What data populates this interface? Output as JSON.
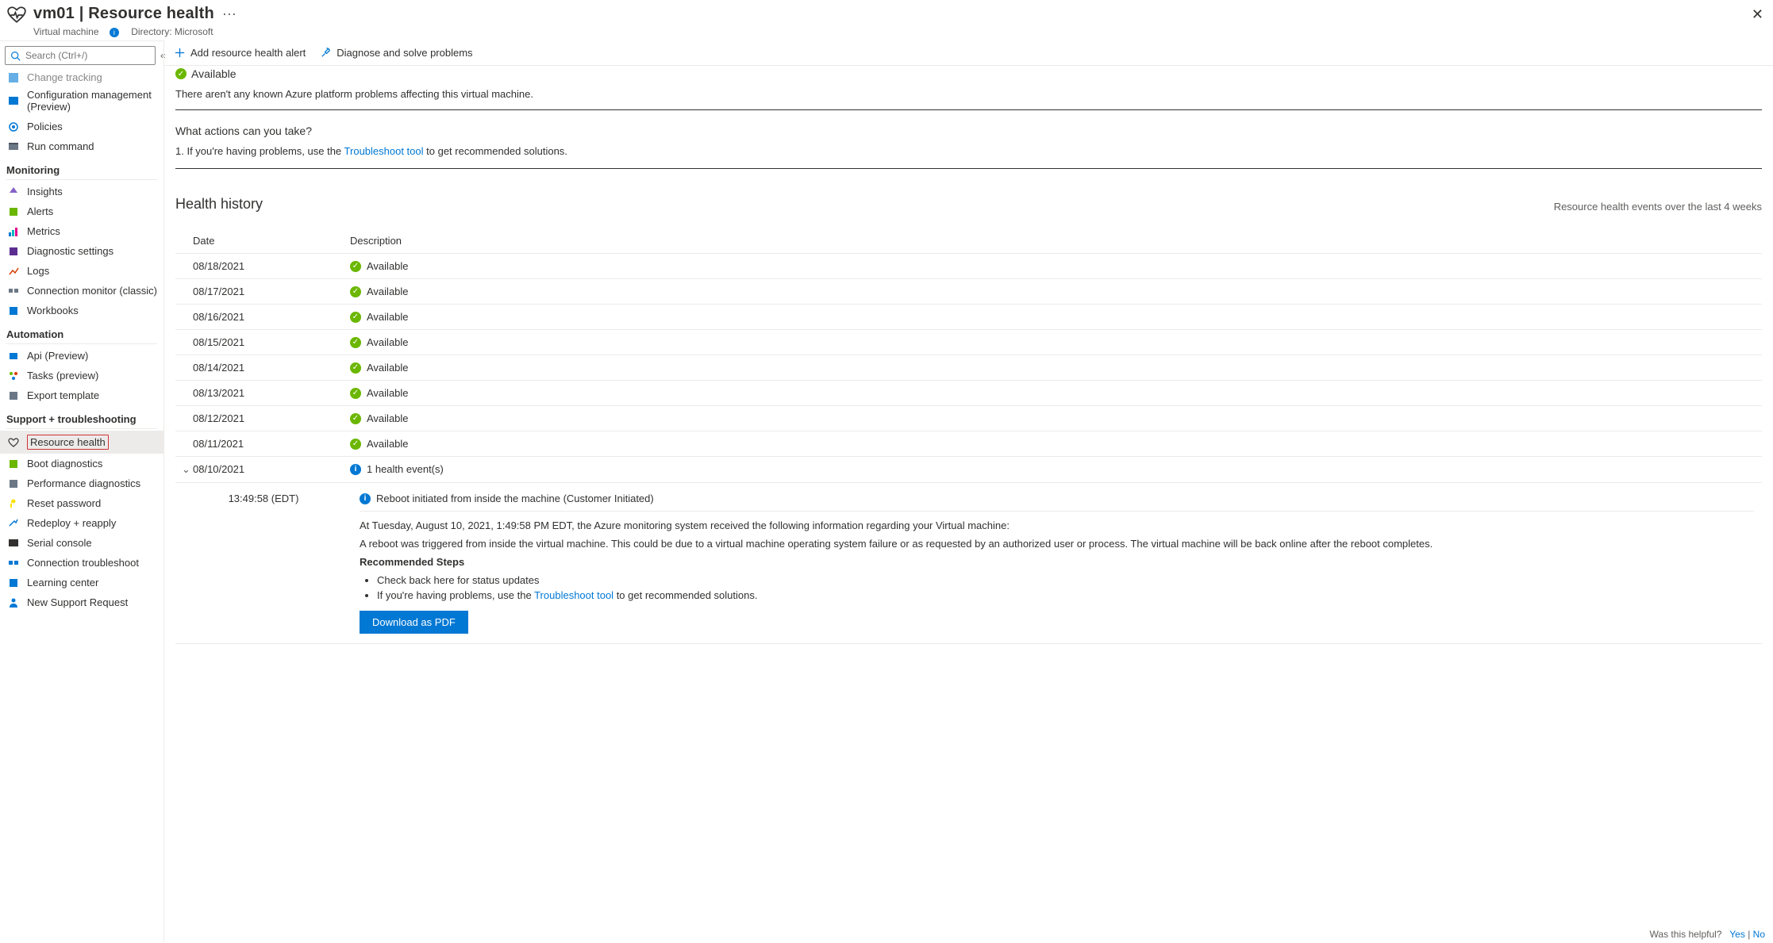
{
  "header": {
    "title": "vm01 | Resource health",
    "subtitle_type": "Virtual machine",
    "directory_label": "Directory: Microsoft"
  },
  "search": {
    "placeholder": "Search (Ctrl+/)"
  },
  "sidebar": {
    "top_truncated": "Change tracking",
    "items0": [
      "Configuration management (Preview)",
      "Policies",
      "Run command"
    ],
    "section1": {
      "title": "Monitoring",
      "items": [
        "Insights",
        "Alerts",
        "Metrics",
        "Diagnostic settings",
        "Logs",
        "Connection monitor (classic)",
        "Workbooks"
      ]
    },
    "section2": {
      "title": "Automation",
      "items": [
        "Api (Preview)",
        "Tasks (preview)",
        "Export template"
      ]
    },
    "section3": {
      "title": "Support + troubleshooting",
      "items": [
        "Resource health",
        "Boot diagnostics",
        "Performance diagnostics",
        "Reset password",
        "Redeploy + reapply",
        "Serial console",
        "Connection troubleshoot",
        "Learning center",
        "New Support Request"
      ]
    }
  },
  "toolbar": {
    "add_alert": "Add resource health alert",
    "diagnose": "Diagnose and solve problems"
  },
  "status": {
    "state": "Available",
    "subtext": "There aren't any known Azure platform problems affecting this virtual machine."
  },
  "actions": {
    "heading": "What actions can you take?",
    "prefix": "1.  If you're having problems, use the ",
    "link": "Troubleshoot tool",
    "suffix": " to get recommended solutions."
  },
  "history": {
    "title": "Health history",
    "range": "Resource health events over the last 4 weeks",
    "cols": {
      "date": "Date",
      "desc": "Description"
    },
    "rows": [
      {
        "date": "08/18/2021",
        "status": "Available"
      },
      {
        "date": "08/17/2021",
        "status": "Available"
      },
      {
        "date": "08/16/2021",
        "status": "Available"
      },
      {
        "date": "08/15/2021",
        "status": "Available"
      },
      {
        "date": "08/14/2021",
        "status": "Available"
      },
      {
        "date": "08/13/2021",
        "status": "Available"
      },
      {
        "date": "08/12/2021",
        "status": "Available"
      },
      {
        "date": "08/11/2021",
        "status": "Available"
      }
    ],
    "expanded": {
      "date": "08/10/2021",
      "summary": "1 health event(s)",
      "time": "13:49:58 (EDT)",
      "title": "Reboot initiated from inside the machine (Customer Initiated)",
      "p1": "At Tuesday, August 10, 2021, 1:49:58 PM EDT, the Azure monitoring system received the following information regarding your Virtual machine:",
      "p2": "A reboot was triggered from inside the virtual machine. This could be due to a virtual machine operating system failure or as requested by an authorized user or process. The virtual machine will be back online after the reboot completes.",
      "rec_h": "Recommended Steps",
      "rec1": "Check back here for status updates",
      "rec2_pre": "If you're having problems, use the ",
      "rec2_link": "Troubleshoot tool",
      "rec2_post": " to get recommended solutions.",
      "download": "Download as PDF"
    }
  },
  "feedback": {
    "q": "Was this helpful?",
    "yes": "Yes",
    "no": "No"
  }
}
